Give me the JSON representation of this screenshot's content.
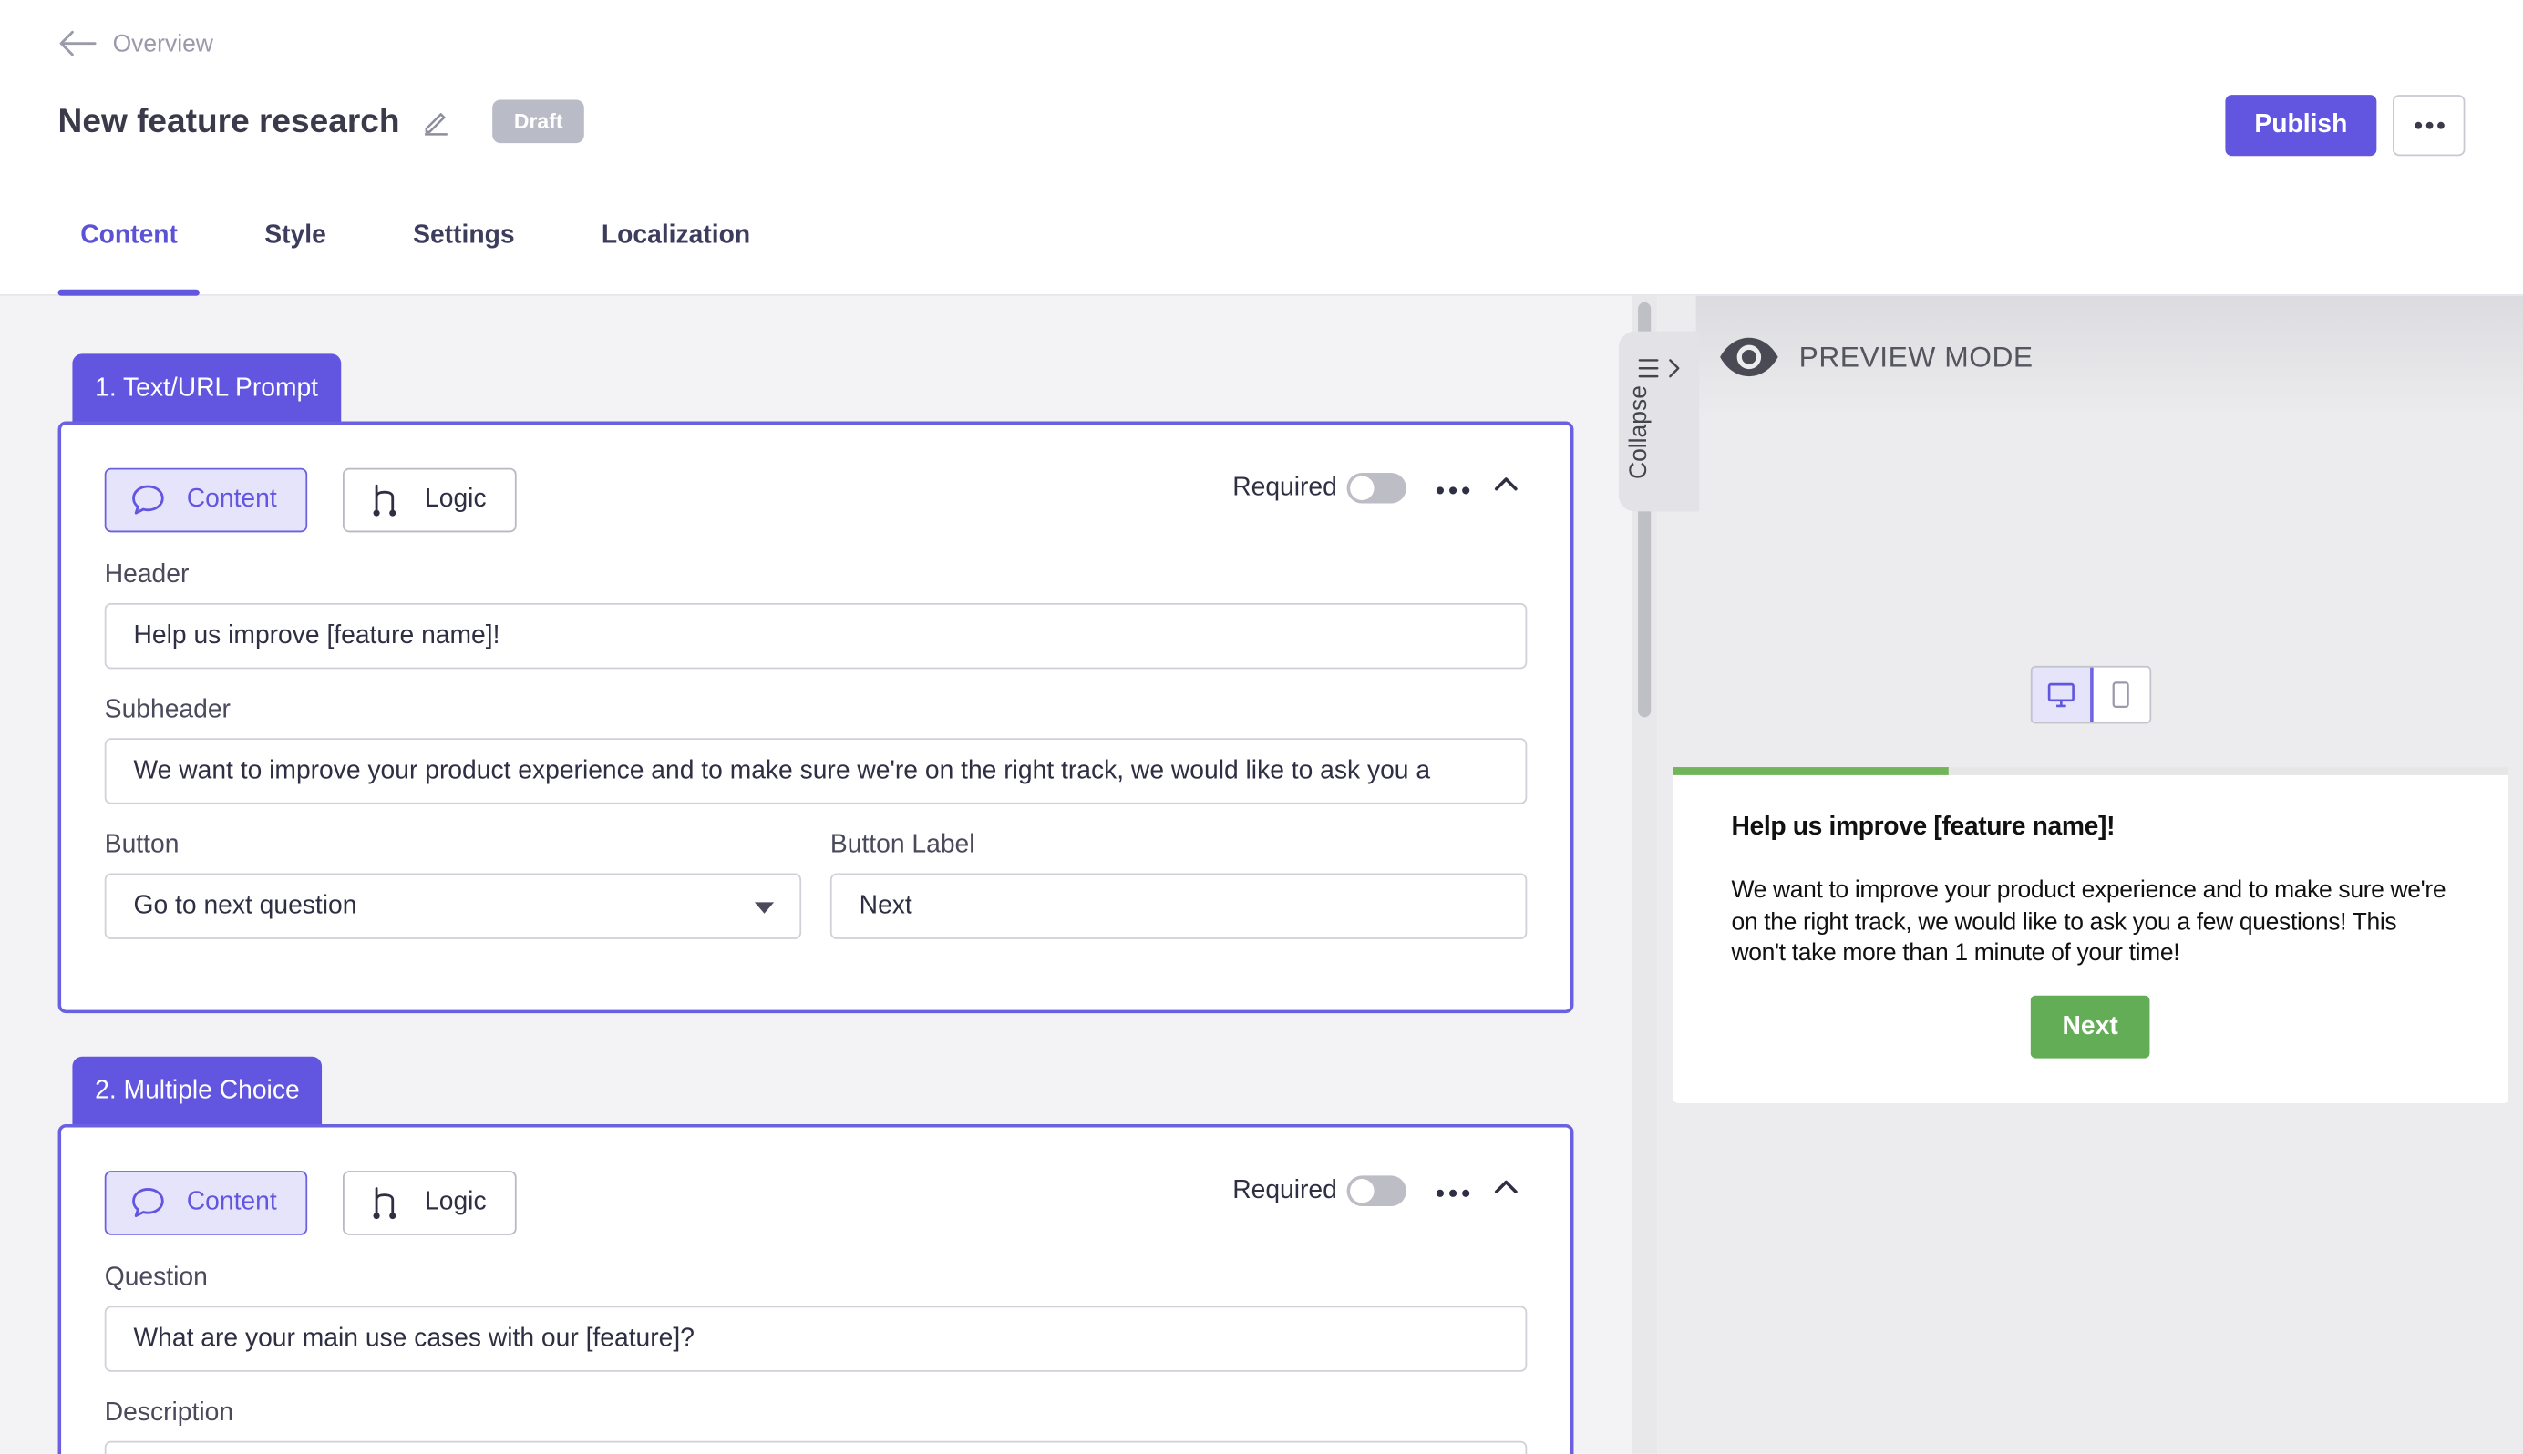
{
  "nav": {
    "back_label": "Overview"
  },
  "survey": {
    "title": "New feature research",
    "status": "Draft"
  },
  "actions": {
    "publish_label": "Publish"
  },
  "tabs": [
    {
      "label": "Content",
      "active": true
    },
    {
      "label": "Style",
      "active": false
    },
    {
      "label": "Settings",
      "active": false
    },
    {
      "label": "Localization",
      "active": false
    }
  ],
  "questions": [
    {
      "tag": "1. Text/URL Prompt",
      "content_label": "Content",
      "logic_label": "Logic",
      "required_label": "Required",
      "header_label": "Header",
      "header_value": "Help us improve [feature name]!",
      "subheader_label": "Subheader",
      "subheader_value": "We want to improve your product experience and to make sure we're on the right track, we would like to ask you a",
      "button_label": "Button",
      "button_value": "Go to next question",
      "button_text_label": "Button Label",
      "button_text_value": "Next"
    },
    {
      "tag": "2. Multiple Choice",
      "content_label": "Content",
      "logic_label": "Logic",
      "required_label": "Required",
      "question_label": "Question",
      "question_value": "What are your main use cases with our [feature]?",
      "description_label": "Description"
    }
  ],
  "sidebar": {
    "collapse_label": "Collapse"
  },
  "preview": {
    "mode_label": "PREVIEW MODE",
    "progress": 0.33,
    "title": "Help us improve [feature name]!",
    "text": "We want to improve your product experience and to make sure we're on the right track, we would like to ask you a few questions! This won't take more than 1 minute of your time!",
    "button": "Next",
    "accent": "#62ad55"
  },
  "colors": {
    "primary": "#6256e0",
    "draft_badge": "#b9bcc6"
  }
}
